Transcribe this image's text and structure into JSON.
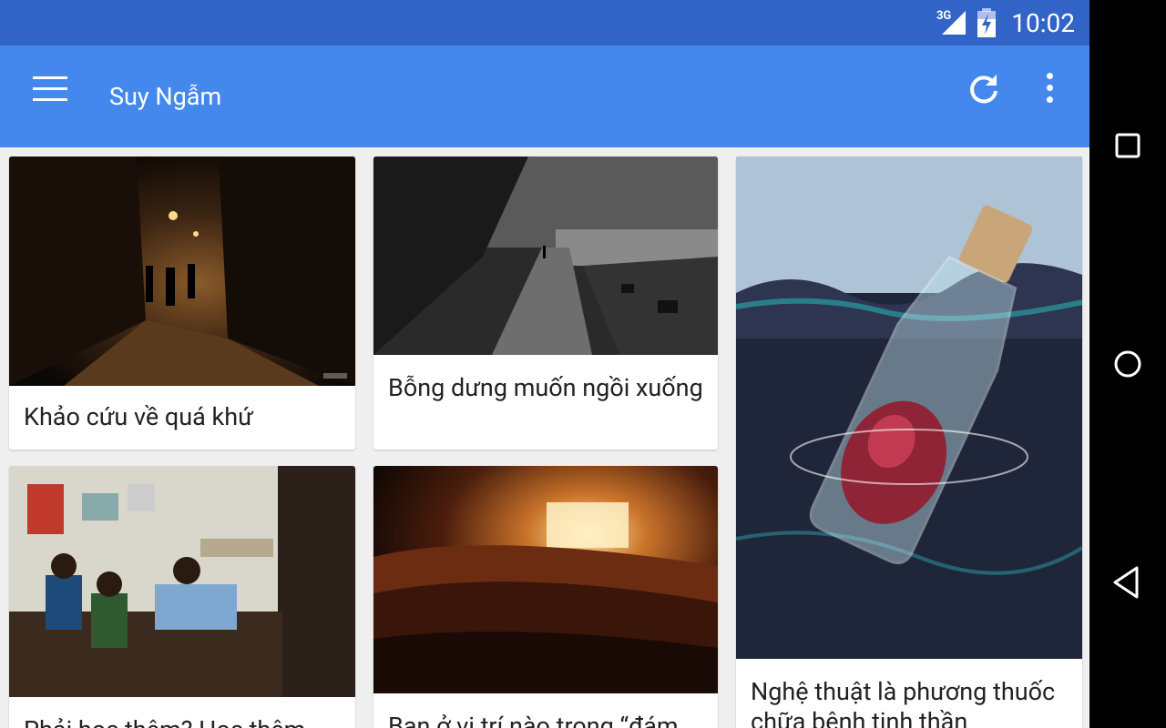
{
  "status": {
    "network": "3G",
    "time": "10:02"
  },
  "app": {
    "title": "Suy Ngẫm"
  },
  "icons": {
    "menu": "menu-icon",
    "refresh": "refresh-icon",
    "overflow": "more-vert-icon",
    "recents": "square-icon",
    "home": "circle-icon",
    "back": "triangle-back-icon"
  },
  "colors": {
    "status_bar": "#3264c8",
    "app_bar": "#4488ee",
    "background": "#efefef",
    "nav_bar": "#000000"
  },
  "cards": [
    {
      "title": "Khảo cứu về quá khứ"
    },
    {
      "title": "Bỗng dưng muốn ngồi xuống"
    },
    {
      "title": "Nghệ thuật là phương thuốc chữa bệnh tinh thần"
    },
    {
      "title": "Phải học thêm? Học thêm"
    },
    {
      "title": "Bạn ở vị trí nào trong “đám"
    }
  ]
}
